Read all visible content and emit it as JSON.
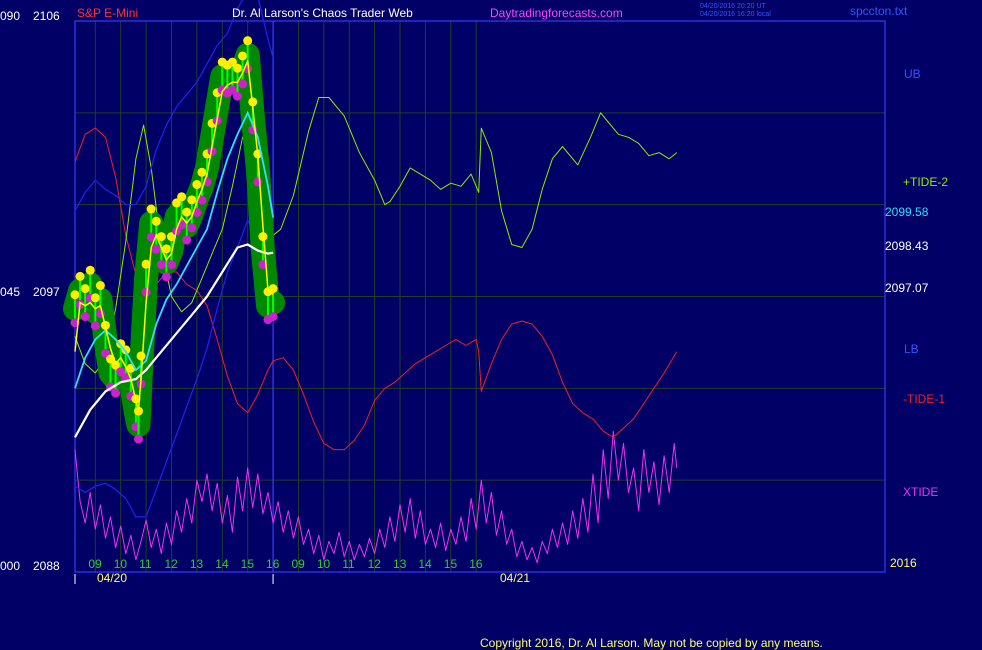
{
  "header": {
    "instrument": "S&P E-Mini",
    "site_title": "Dr. Al Larson's Chaos Trader Web",
    "site_link": "Daytradingforecasts.com",
    "time_ut": "04/20/2016 20:20 UT",
    "time_local": "04/20/2016 16:20 local",
    "file_name": "spccton.txt"
  },
  "left_axis": {
    "top": {
      "a": "090",
      "b": "2106"
    },
    "mid": {
      "a": "045",
      "b": "2097"
    },
    "bottom": {
      "a": "000",
      "b": "2088"
    }
  },
  "right_labels": {
    "ub": "UB",
    "tide2": "+TIDE-2",
    "cyan_value": "2099.58",
    "white_value": "2098.43",
    "yellow_value": "2097.07",
    "lb": "LB",
    "tide1": "-TIDE-1",
    "xtide": "XTIDE",
    "year": "2016"
  },
  "copyright": "Copyright 2016, Dr. Al Larson. May not be copied by any means.",
  "colors": {
    "background": "#000066",
    "plot_border": "#3a3aff",
    "grid": "#204020",
    "instrument": "#ff3333",
    "title": "#ffffff",
    "link": "#ff44ff",
    "price_band": "#008800",
    "bar": "#00ff00",
    "high_dot": "#ffee00",
    "low_dot": "#cc22cc",
    "yellow_avg": "#ffff00",
    "cyan_avg": "#33ddff",
    "white_avg": "#ffffff",
    "bands": "#2222ee",
    "tide2": "#88ee00",
    "tide1": "#ee2222",
    "xtide": "#ee33ee",
    "date_label": "#ffff66",
    "hour_label": "#33cc33"
  },
  "chart_data": {
    "type": "line",
    "title": "S&P E-Mini",
    "y_left_a": {
      "ticks": [
        "000",
        "045",
        "090"
      ],
      "range": [
        0,
        90
      ]
    },
    "y_left_b": {
      "ticks": [
        2088,
        2097,
        2106
      ],
      "range": [
        2088,
        2106
      ]
    },
    "x_hour_ticks": [
      "09",
      "10",
      "11",
      "12",
      "13",
      "14",
      "15",
      "16",
      "09",
      "10",
      "11",
      "12",
      "13",
      "14",
      "15",
      "16"
    ],
    "x_date_labels": [
      "04/20",
      "04/21"
    ],
    "x_range_hours": [
      8.2,
      40.1
    ],
    "last_values": {
      "cyan": 2099.58,
      "white": 2098.43,
      "yellow": 2097.07
    },
    "series": [
      {
        "name": "price_close",
        "x": [
          8.2,
          8.4,
          8.6,
          8.8,
          9.0,
          9.2,
          9.4,
          9.6,
          9.8,
          10.0,
          10.2,
          10.4,
          10.6,
          10.7,
          10.8,
          11.0,
          11.2,
          11.4,
          11.6,
          11.8,
          12.0,
          12.2,
          12.4,
          12.6,
          12.8,
          13.0,
          13.2,
          13.4,
          13.6,
          13.8,
          14.0,
          14.2,
          14.4,
          14.6,
          14.8,
          15.0,
          15.2,
          15.4,
          15.6,
          15.8,
          16.0
        ],
        "y": [
          2096.6,
          2097.2,
          2096.8,
          2097.4,
          2096.5,
          2096.9,
          2095.6,
          2094.5,
          2094.3,
          2095.0,
          2094.8,
          2094.2,
          2093.2,
          2092.8,
          2094.6,
          2097.6,
          2099.4,
          2099.0,
          2098.5,
          2098.1,
          2098.5,
          2099.6,
          2099.8,
          2099.3,
          2099.7,
          2100.2,
          2100.6,
          2101.2,
          2102.2,
          2103.2,
          2104.2,
          2104.1,
          2104.2,
          2104.0,
          2104.4,
          2104.9,
          2102.9,
          2101.2,
          2098.5,
          2096.7,
          2096.8
        ]
      },
      {
        "name": "yellow_avg",
        "x": [
          8.2,
          8.4,
          8.6,
          8.8,
          9.0,
          9.2,
          9.4,
          9.6,
          9.8,
          10.0,
          10.2,
          10.4,
          10.6,
          10.7,
          10.8,
          11.0,
          11.2,
          11.4,
          11.6,
          11.8,
          12.0,
          12.2,
          12.4,
          12.6,
          12.8,
          13.0,
          13.2,
          13.4,
          13.6,
          13.8,
          14.0,
          14.2,
          14.4,
          14.6,
          14.8,
          15.0,
          15.2,
          15.4,
          15.6,
          15.8,
          16.0
        ],
        "y": [
          2095.2,
          2096.8,
          2096.7,
          2096.8,
          2096.6,
          2096.7,
          2096.0,
          2095.3,
          2094.8,
          2095.0,
          2094.7,
          2094.3,
          2093.6,
          2093.3,
          2094.3,
          2096.8,
          2098.6,
          2099.0,
          2098.6,
          2098.2,
          2098.4,
          2099.2,
          2099.6,
          2099.4,
          2099.6,
          2100.1,
          2100.5,
          2101.0,
          2101.9,
          2102.8,
          2103.7,
          2103.9,
          2104.0,
          2104.0,
          2104.3,
          2104.7,
          2103.2,
          2101.6,
          2099.3,
          2097.2,
          2097.07
        ]
      },
      {
        "name": "cyan_avg",
        "x": [
          8.2,
          8.6,
          9.0,
          9.4,
          9.8,
          10.2,
          10.6,
          11.0,
          11.4,
          11.8,
          12.2,
          12.6,
          13.0,
          13.4,
          13.8,
          14.2,
          14.6,
          15.0,
          15.4,
          15.8,
          16.0
        ],
        "y": [
          2094.0,
          2095.0,
          2095.6,
          2095.9,
          2095.6,
          2095.2,
          2094.6,
          2094.9,
          2096.1,
          2096.9,
          2097.4,
          2098.0,
          2098.6,
          2099.2,
          2100.4,
          2101.5,
          2102.3,
          2103.0,
          2102.2,
          2100.6,
          2099.58
        ]
      },
      {
        "name": "white_avg",
        "x": [
          8.2,
          8.8,
          9.4,
          10.0,
          10.6,
          11.0,
          11.6,
          12.2,
          12.8,
          13.4,
          14.0,
          14.6,
          15.0,
          15.4,
          15.8,
          16.0
        ],
        "y": [
          2092.4,
          2093.3,
          2093.9,
          2094.2,
          2094.3,
          2094.6,
          2095.2,
          2095.8,
          2096.4,
          2097.0,
          2097.8,
          2098.6,
          2098.7,
          2098.5,
          2098.4,
          2098.43
        ]
      },
      {
        "name": "upper_band",
        "x": [
          8.2,
          8.6,
          9.0,
          9.4,
          9.8,
          10.2,
          10.6,
          11.0,
          11.4,
          11.8,
          12.2,
          12.6,
          13.0,
          13.4,
          13.8,
          14.2,
          14.6,
          15.0,
          15.4,
          15.8,
          16.0
        ],
        "y": [
          2099.8,
          2100.4,
          2100.8,
          2100.5,
          2100.3,
          2100.0,
          2100.0,
          2100.6,
          2101.8,
          2102.6,
          2103.2,
          2103.6,
          2104.0,
          2104.6,
          2105.2,
          2105.6,
          2106.4,
          2107.0,
          2106.8,
          2105.4,
          2104.8
        ]
      },
      {
        "name": "lower_band",
        "x": [
          8.2,
          8.6,
          9.0,
          9.4,
          9.8,
          10.2,
          10.6,
          11.0,
          11.4,
          11.8,
          12.2,
          12.6,
          13.0,
          13.4,
          13.8,
          14.2,
          14.6,
          15.0,
          15.4,
          15.8,
          16.0
        ],
        "y": [
          2090.8,
          2090.6,
          2090.8,
          2090.9,
          2090.7,
          2090.4,
          2089.8,
          2089.8,
          2090.7,
          2091.6,
          2092.5,
          2093.4,
          2094.3,
          2095.3,
          2096.6,
          2097.8,
          2098.6,
          2099.5,
          2098.8,
          2097.6,
          2097.3
        ]
      },
      {
        "name": "+TIDE-2",
        "x": [
          8.2,
          8.6,
          9.0,
          9.4,
          9.8,
          10.2,
          10.6,
          10.9,
          11.2,
          11.6,
          12.0,
          12.4,
          12.8,
          13.2,
          13.6,
          14.0,
          14.4,
          14.8,
          15.0,
          15.2,
          15.4,
          15.8,
          16.0,
          16.3,
          16.8,
          17.4,
          17.8,
          18.2,
          18.8,
          19.4,
          20.0,
          20.4,
          20.6,
          21.0,
          21.4,
          21.8,
          22.2,
          22.6,
          23.0,
          23.4,
          23.8,
          24.1,
          24.2,
          24.6,
          25.0,
          25.4,
          25.8,
          26.2,
          26.6,
          27.0,
          27.4,
          28.0,
          28.5,
          28.9,
          29.2,
          29.6,
          30.0,
          30.4,
          30.8,
          31.2,
          31.6,
          31.9
        ],
        "y": [
          2095.7,
          2094.8,
          2094.5,
          2095.0,
          2096.6,
          2098.8,
          2101.5,
          2102.6,
          2101.2,
          2098.6,
          2097.0,
          2096.5,
          2096.8,
          2097.6,
          2098.4,
          2099.2,
          2100.6,
          2102.2,
          2102.6,
          2102.0,
          2101.0,
          2099.4,
          2099.0,
          2099.2,
          2100.3,
          2102.4,
          2103.5,
          2103.5,
          2102.9,
          2101.7,
          2100.8,
          2100.0,
          2100.1,
          2100.6,
          2101.2,
          2101.0,
          2100.8,
          2100.5,
          2100.7,
          2100.6,
          2101.0,
          2100.4,
          2102.5,
          2101.7,
          2099.8,
          2098.7,
          2098.6,
          2099.2,
          2100.5,
          2101.5,
          2101.9,
          2101.3,
          2102.2,
          2103.0,
          2102.7,
          2102.3,
          2102.2,
          2102.0,
          2101.6,
          2101.7,
          2101.5,
          2101.7
        ]
      },
      {
        "name": "-TIDE-1",
        "x": [
          8.2,
          8.6,
          9.0,
          9.4,
          9.8,
          10.2,
          10.6,
          11.0,
          11.4,
          11.8,
          12.2,
          12.6,
          13.0,
          13.4,
          13.8,
          14.2,
          14.6,
          15.0,
          15.4,
          15.8,
          16.0,
          16.4,
          16.8,
          17.2,
          17.6,
          18.0,
          18.4,
          18.8,
          19.2,
          19.6,
          20.0,
          20.4,
          20.8,
          21.2,
          21.6,
          22.0,
          22.4,
          22.8,
          23.2,
          23.6,
          24.0,
          24.1,
          24.2,
          24.6,
          25.0,
          25.4,
          25.8,
          26.2,
          26.6,
          27.0,
          27.4,
          27.8,
          28.2,
          28.6,
          29.0,
          29.4,
          29.8,
          30.2,
          30.6,
          31.0,
          31.4,
          31.9
        ],
        "y": [
          2101.4,
          2102.3,
          2102.5,
          2102.2,
          2100.9,
          2099.0,
          2097.7,
          2097.0,
          2097.4,
          2097.8,
          2097.8,
          2097.4,
          2097.2,
          2096.7,
          2095.6,
          2094.4,
          2093.5,
          2093.2,
          2093.8,
          2094.6,
          2094.9,
          2095.0,
          2094.6,
          2093.8,
          2092.9,
          2092.2,
          2092.0,
          2092.0,
          2092.3,
          2092.8,
          2093.6,
          2094.0,
          2094.2,
          2094.5,
          2094.8,
          2095.0,
          2095.2,
          2095.4,
          2095.6,
          2095.4,
          2095.6,
          2095.2,
          2093.9,
          2094.8,
          2095.6,
          2096.1,
          2096.2,
          2096.1,
          2095.7,
          2095.1,
          2094.2,
          2093.5,
          2093.2,
          2093.0,
          2092.6,
          2092.4,
          2092.7,
          2093.0,
          2093.5,
          2094.0,
          2094.5,
          2095.2
        ]
      },
      {
        "name": "XTIDE",
        "x": [
          8.2,
          8.4,
          8.6,
          8.8,
          9.0,
          9.2,
          9.4,
          9.6,
          9.8,
          10.0,
          10.2,
          10.4,
          10.6,
          10.8,
          11.0,
          11.2,
          11.4,
          11.6,
          11.8,
          12.0,
          12.2,
          12.4,
          12.6,
          12.8,
          13.0,
          13.2,
          13.4,
          13.6,
          13.8,
          14.0,
          14.2,
          14.4,
          14.6,
          14.8,
          15.0,
          15.2,
          15.4,
          15.6,
          15.8,
          16.0,
          16.2,
          16.4,
          16.6,
          16.8,
          17.0,
          17.2,
          17.4,
          17.6,
          17.8,
          18.0,
          18.2,
          18.4,
          18.6,
          18.8,
          19.0,
          19.2,
          19.4,
          19.6,
          19.8,
          20.0,
          20.2,
          20.4,
          20.6,
          20.8,
          21.0,
          21.2,
          21.4,
          21.6,
          21.8,
          22.0,
          22.2,
          22.4,
          22.6,
          22.8,
          23.0,
          23.2,
          23.4,
          23.6,
          23.8,
          24.0,
          24.2,
          24.4,
          24.6,
          24.8,
          25.0,
          25.2,
          25.4,
          25.6,
          25.8,
          26.0,
          26.2,
          26.4,
          26.6,
          26.8,
          27.0,
          27.2,
          27.4,
          27.6,
          27.8,
          28.0,
          28.2,
          28.4,
          28.6,
          28.8,
          29.0,
          29.2,
          29.4,
          29.6,
          29.8,
          30.0,
          30.2,
          30.4,
          30.6,
          30.8,
          31.0,
          31.2,
          31.4,
          31.6,
          31.8,
          31.9
        ],
        "y": [
          2092.0,
          2090.3,
          2089.6,
          2090.6,
          2089.4,
          2090.2,
          2089.1,
          2089.8,
          2088.8,
          2089.5,
          2088.6,
          2089.2,
          2088.4,
          2089.0,
          2089.7,
          2088.8,
          2089.4,
          2088.6,
          2089.6,
          2088.9,
          2090.0,
          2089.3,
          2090.4,
          2089.6,
          2091.0,
          2090.3,
          2091.2,
          2090.0,
          2090.9,
          2089.6,
          2090.5,
          2089.3,
          2091.1,
          2090.0,
          2091.4,
          2090.1,
          2091.2,
          2089.9,
          2090.6,
          2089.6,
          2090.3,
          2089.3,
          2090.0,
          2089.1,
          2089.8,
          2088.9,
          2089.4,
          2088.6,
          2089.2,
          2088.4,
          2089.0,
          2088.6,
          2089.3,
          2088.5,
          2089.0,
          2088.4,
          2088.9,
          2088.5,
          2089.1,
          2088.6,
          2089.4,
          2088.8,
          2089.8,
          2089.0,
          2090.2,
          2089.3,
          2090.4,
          2089.1,
          2090.0,
          2088.9,
          2089.4,
          2088.8,
          2089.6,
          2088.7,
          2089.4,
          2088.9,
          2089.8,
          2089.0,
          2090.4,
          2089.4,
          2091.0,
          2089.6,
          2090.6,
          2089.2,
          2090.0,
          2088.9,
          2089.4,
          2088.5,
          2089.0,
          2088.4,
          2088.8,
          2088.3,
          2089.0,
          2088.6,
          2089.4,
          2088.8,
          2089.6,
          2088.9,
          2090.0,
          2089.1,
          2090.4,
          2089.3,
          2091.2,
          2089.6,
          2092.0,
          2090.4,
          2092.6,
          2091.0,
          2092.2,
          2090.6,
          2091.4,
          2090.0,
          2092.0,
          2090.6,
          2091.6,
          2090.2,
          2091.8,
          2090.6,
          2092.2,
          2091.4
        ]
      }
    ]
  }
}
